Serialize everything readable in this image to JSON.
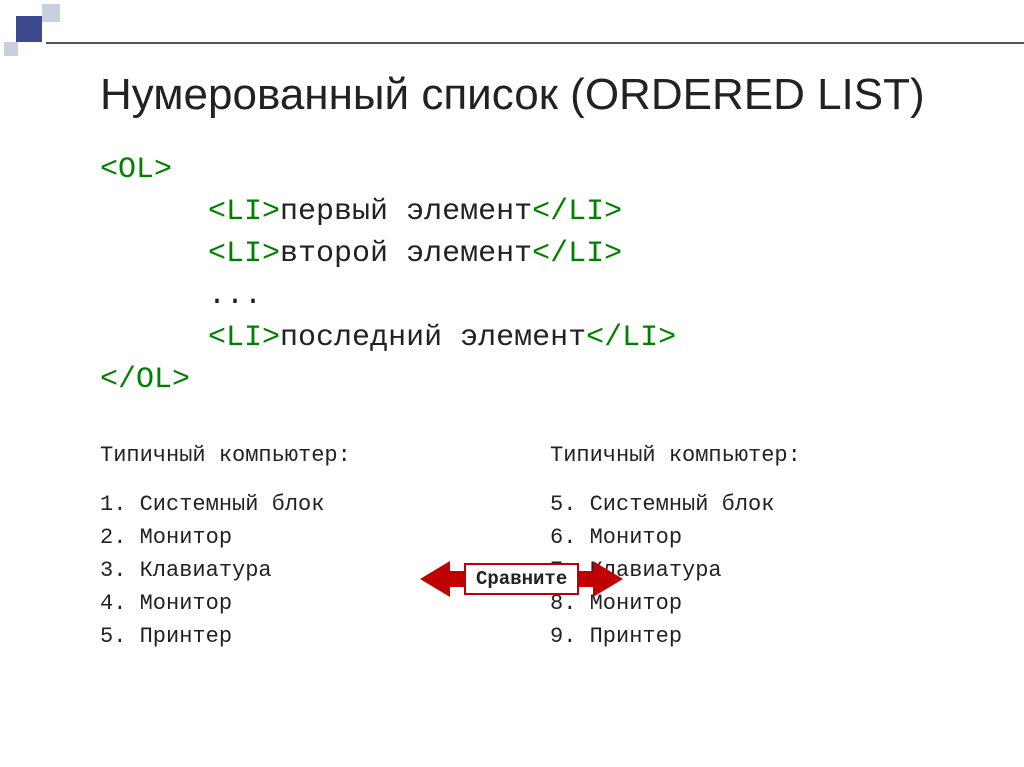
{
  "title": "Нумерованный список (ORDERED LIST)",
  "code": {
    "open": "<OL>",
    "l1_open": "<LI>",
    "l1_text": "первый элемент",
    "l1_close": "</LI>",
    "l2_open": "<LI>",
    "l2_text": "второй элемент",
    "l2_close": "</LI>",
    "dots": "...",
    "l3_open": "<LI>",
    "l3_text": "последний элемент",
    "l3_close": "</LI>",
    "close": "</OL>"
  },
  "exampleLeft": {
    "heading": "Типичный компьютер:",
    "items": [
      "1. Системный блок",
      "2. Монитор",
      "3. Клавиатура",
      "4. Монитор",
      "5. Принтер"
    ]
  },
  "exampleRight": {
    "heading": "Типичный компьютер:",
    "items": [
      "5. Системный блок",
      "6. Монитор",
      "7. Клавиатура",
      "8. Монитор",
      "9. Принтер"
    ]
  },
  "compare": "Сравните"
}
